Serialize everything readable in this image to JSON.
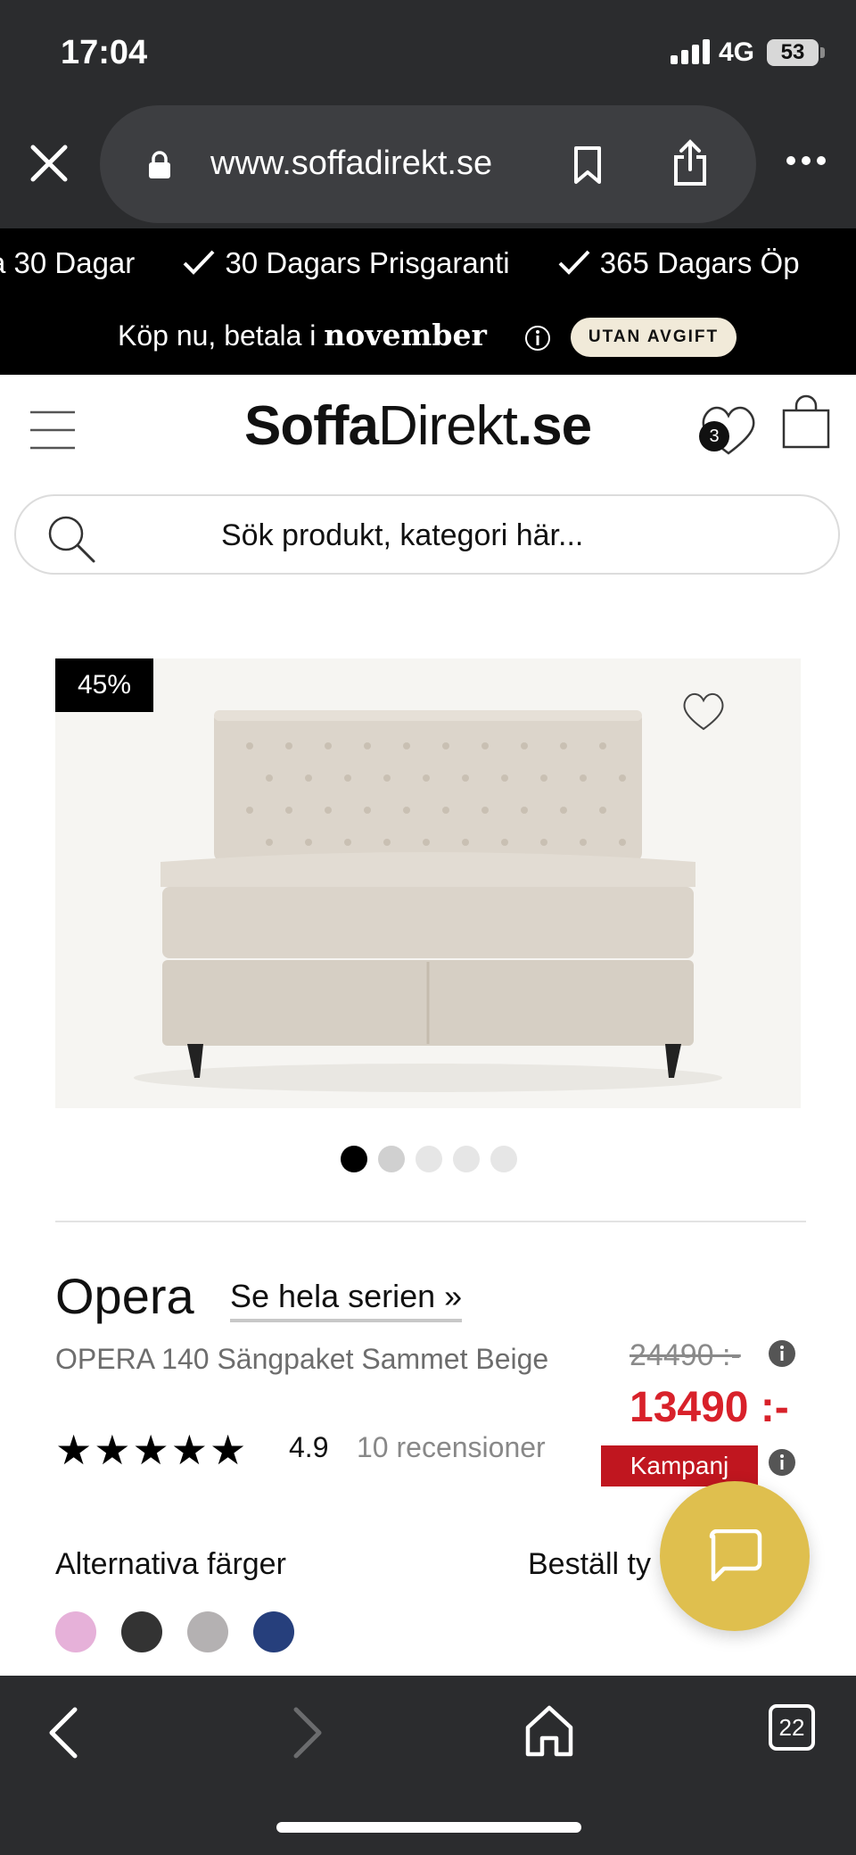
{
  "status_bar": {
    "time": "17:04",
    "network": "4G",
    "battery": "53"
  },
  "browser": {
    "url": "www.soffadirekt.se",
    "tab_count": "22"
  },
  "usp_bar": {
    "items": [
      "a 30 Dagar",
      "30 Dagars Prisgaranti",
      "365 Dagars Öp"
    ]
  },
  "payment_bar": {
    "prefix": "Köp nu, betala i ",
    "month": "november",
    "pill": "UTAN AVGIFT"
  },
  "header": {
    "logo_bold": "Soffa",
    "logo_regular": "Direkt",
    "logo_suffix": ".se",
    "wishlist_count": "3",
    "search_placeholder": "Sök produkt, kategori här..."
  },
  "product": {
    "discount": "45%",
    "image_index": 1,
    "image_count": 5,
    "series": "Opera",
    "series_link": "Se hela serien »",
    "title": "OPERA 140 Sängpaket Sammet Beige",
    "stars": "★★★★★",
    "rating": "4.9",
    "reviews": "10 recensioner",
    "old_price": "24490 :-",
    "price": "13490 :-",
    "campaign": "Kampanj",
    "alt_colors_label": "Alternativa färger",
    "order_fabric_label": "Beställ ty",
    "swatches": [
      "#e6b1d9",
      "#333333",
      "#b4b1b2",
      "#263f7c"
    ]
  },
  "colors": {
    "price_red": "#d8212a",
    "campaign_red": "#c0161f",
    "chat_gold": "#dfbf4e",
    "chrome": "#2b2c2e"
  },
  "icons": [
    "close-icon",
    "lock-icon",
    "bookmark-icon",
    "share-icon",
    "more-icon",
    "check-icon",
    "info-icon",
    "menu-icon",
    "heart-icon",
    "cart-icon",
    "search-icon",
    "chat-icon",
    "back-icon",
    "forward-icon",
    "home-icon"
  ]
}
